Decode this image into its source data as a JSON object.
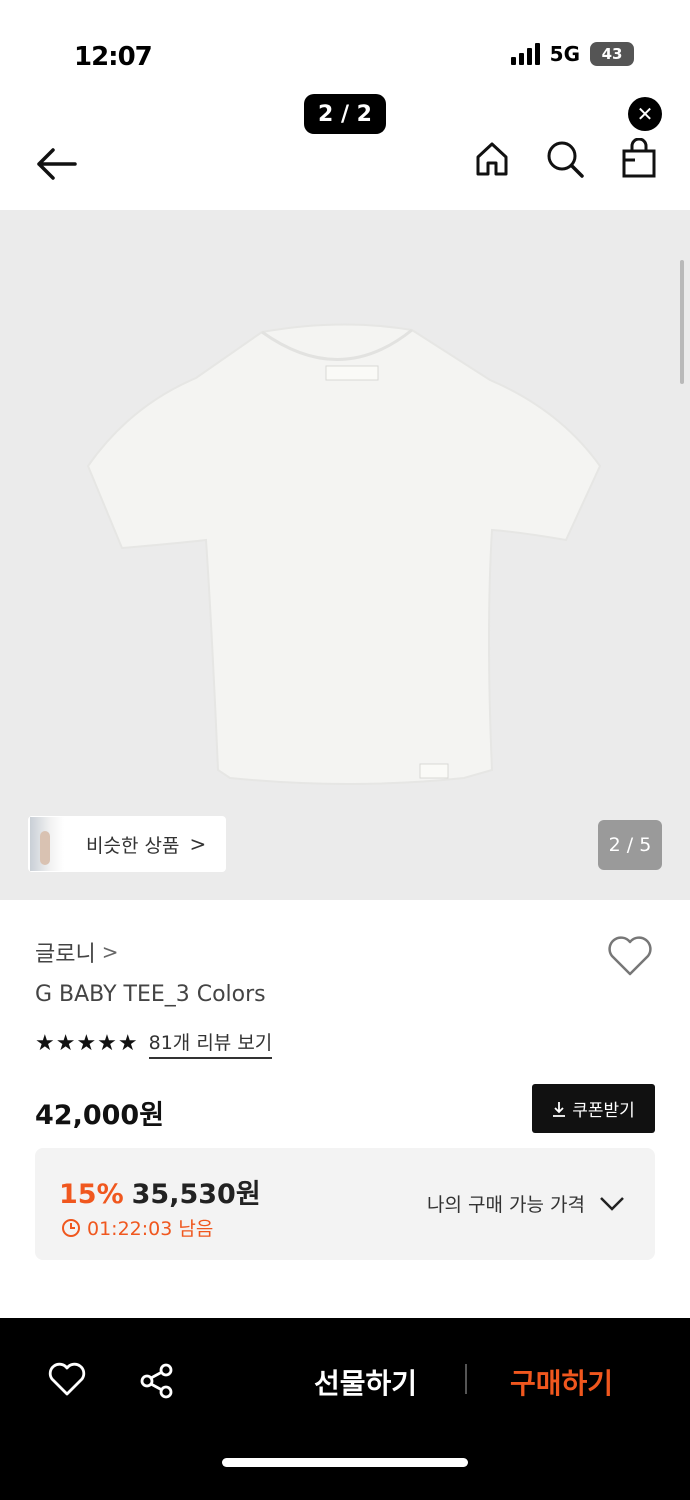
{
  "status_bar": {
    "time": "12:07",
    "network": "5G",
    "battery": "43"
  },
  "viewer": {
    "page_indicator": "2 / 2"
  },
  "header": {
    "back_icon": "back-arrow-icon",
    "home_icon": "home-icon",
    "search_icon": "search-icon",
    "bag_icon": "shopping-bag-icon"
  },
  "gallery": {
    "similar_label": "비슷한 상품",
    "similar_chevron": ">",
    "counter": "2 / 5",
    "image_description_icon": "white-tshirt-image"
  },
  "product": {
    "brand": "글로니",
    "brand_chevron": ">",
    "name": "G BABY TEE_3 Colors",
    "rating_stars": "★★★★★",
    "rating_value": 5,
    "review_link": "81개 리뷰 보기",
    "price": "42,000원"
  },
  "coupon": {
    "label": "쿠폰받기",
    "icon": "download-icon"
  },
  "discount": {
    "rate": "15%",
    "price": "35,530원",
    "timer": "01:22:03 남음",
    "my_price_label": "나의 구매 가능 가격",
    "colors": {
      "accent": "#f0571e"
    }
  },
  "bottom_bar": {
    "gift_label": "선물하기",
    "buy_label": "구매하기",
    "heart_icon": "heart-icon",
    "share_icon": "share-icon"
  }
}
